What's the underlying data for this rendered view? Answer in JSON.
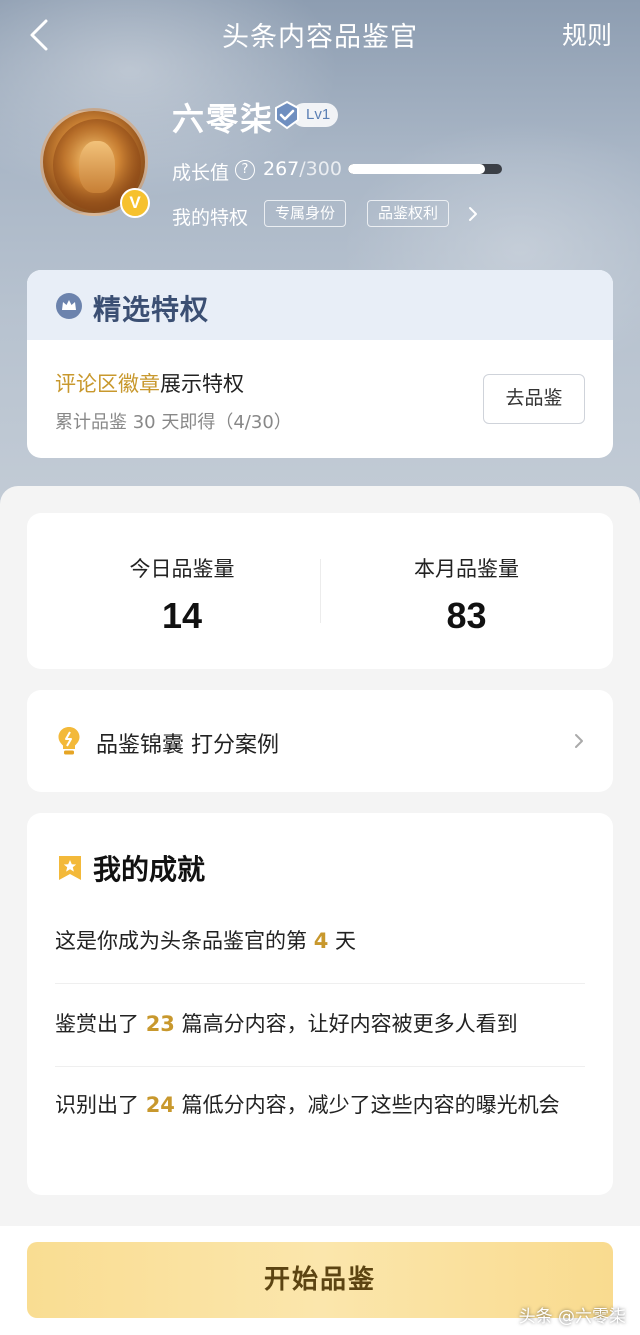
{
  "nav": {
    "title": "头条内容品鉴官",
    "rules_label": "规则"
  },
  "profile": {
    "username": "六零柒",
    "level": "Lv1",
    "avatar_badge": "V",
    "growth_label": "成长值",
    "growth_current": "267",
    "growth_max": "/300",
    "growth_progress": 0.89,
    "privileges_label": "我的特权",
    "privilege_tags": [
      "专属身份",
      "品鉴权利"
    ]
  },
  "featured": {
    "title": "精选特权",
    "badge_highlight": "评论区徽章",
    "badge_rest": "展示特权",
    "badge_sub": "累计品鉴 30 天即得（4/30）",
    "go_button": "去品鉴"
  },
  "stats": {
    "today_label": "今日品鉴量",
    "today_value": "14",
    "month_label": "本月品鉴量",
    "month_value": "83"
  },
  "tips": {
    "text": "品鉴锦囊 打分案例"
  },
  "achievements": {
    "title": "我的成就",
    "row1_pre": "这是你成为头条品鉴官的第 ",
    "row1_num": "4",
    "row1_post": " 天",
    "row2_pre": "鉴赏出了 ",
    "row2_num": "23",
    "row2_post": " 篇高分内容，让好内容被更多人看到",
    "row3_pre": "识别出了 ",
    "row3_num": "24",
    "row3_post": " 篇低分内容，减少了这些内容的曝光机会"
  },
  "footer": {
    "start_button": "开始品鉴",
    "watermark": "头条 @六零柒"
  },
  "colors": {
    "accent_gold": "#c8982d",
    "header_blue": "#3b4f73",
    "button_yellow": "#f9dd92"
  },
  "icons": [
    "back-icon",
    "verified-icon",
    "help-icon",
    "chevron-right-icon",
    "crown-icon",
    "bulb-icon",
    "star-icon"
  ]
}
